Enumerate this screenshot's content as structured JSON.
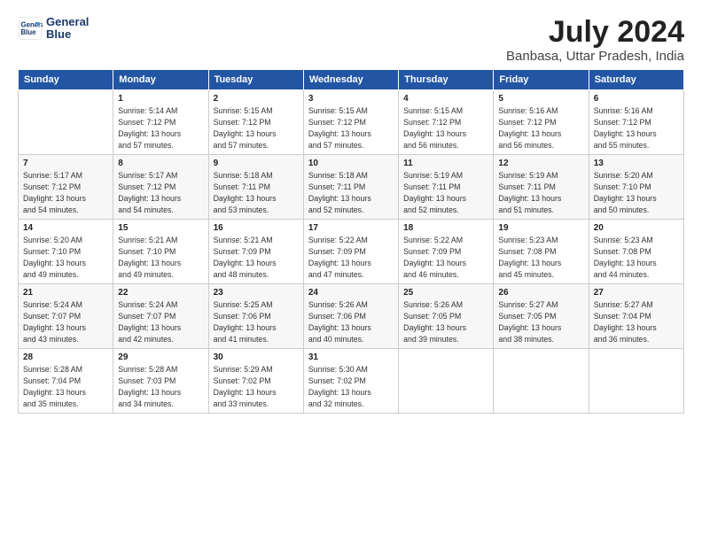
{
  "logo": {
    "line1": "General",
    "line2": "Blue"
  },
  "title": "July 2024",
  "subtitle": "Banbasa, Uttar Pradesh, India",
  "days_header": [
    "Sunday",
    "Monday",
    "Tuesday",
    "Wednesday",
    "Thursday",
    "Friday",
    "Saturday"
  ],
  "weeks": [
    [
      {
        "num": "",
        "info": ""
      },
      {
        "num": "1",
        "info": "Sunrise: 5:14 AM\nSunset: 7:12 PM\nDaylight: 13 hours\nand 57 minutes."
      },
      {
        "num": "2",
        "info": "Sunrise: 5:15 AM\nSunset: 7:12 PM\nDaylight: 13 hours\nand 57 minutes."
      },
      {
        "num": "3",
        "info": "Sunrise: 5:15 AM\nSunset: 7:12 PM\nDaylight: 13 hours\nand 57 minutes."
      },
      {
        "num": "4",
        "info": "Sunrise: 5:15 AM\nSunset: 7:12 PM\nDaylight: 13 hours\nand 56 minutes."
      },
      {
        "num": "5",
        "info": "Sunrise: 5:16 AM\nSunset: 7:12 PM\nDaylight: 13 hours\nand 56 minutes."
      },
      {
        "num": "6",
        "info": "Sunrise: 5:16 AM\nSunset: 7:12 PM\nDaylight: 13 hours\nand 55 minutes."
      }
    ],
    [
      {
        "num": "7",
        "info": "Sunrise: 5:17 AM\nSunset: 7:12 PM\nDaylight: 13 hours\nand 54 minutes."
      },
      {
        "num": "8",
        "info": "Sunrise: 5:17 AM\nSunset: 7:12 PM\nDaylight: 13 hours\nand 54 minutes."
      },
      {
        "num": "9",
        "info": "Sunrise: 5:18 AM\nSunset: 7:11 PM\nDaylight: 13 hours\nand 53 minutes."
      },
      {
        "num": "10",
        "info": "Sunrise: 5:18 AM\nSunset: 7:11 PM\nDaylight: 13 hours\nand 52 minutes."
      },
      {
        "num": "11",
        "info": "Sunrise: 5:19 AM\nSunset: 7:11 PM\nDaylight: 13 hours\nand 52 minutes."
      },
      {
        "num": "12",
        "info": "Sunrise: 5:19 AM\nSunset: 7:11 PM\nDaylight: 13 hours\nand 51 minutes."
      },
      {
        "num": "13",
        "info": "Sunrise: 5:20 AM\nSunset: 7:10 PM\nDaylight: 13 hours\nand 50 minutes."
      }
    ],
    [
      {
        "num": "14",
        "info": "Sunrise: 5:20 AM\nSunset: 7:10 PM\nDaylight: 13 hours\nand 49 minutes."
      },
      {
        "num": "15",
        "info": "Sunrise: 5:21 AM\nSunset: 7:10 PM\nDaylight: 13 hours\nand 49 minutes."
      },
      {
        "num": "16",
        "info": "Sunrise: 5:21 AM\nSunset: 7:09 PM\nDaylight: 13 hours\nand 48 minutes."
      },
      {
        "num": "17",
        "info": "Sunrise: 5:22 AM\nSunset: 7:09 PM\nDaylight: 13 hours\nand 47 minutes."
      },
      {
        "num": "18",
        "info": "Sunrise: 5:22 AM\nSunset: 7:09 PM\nDaylight: 13 hours\nand 46 minutes."
      },
      {
        "num": "19",
        "info": "Sunrise: 5:23 AM\nSunset: 7:08 PM\nDaylight: 13 hours\nand 45 minutes."
      },
      {
        "num": "20",
        "info": "Sunrise: 5:23 AM\nSunset: 7:08 PM\nDaylight: 13 hours\nand 44 minutes."
      }
    ],
    [
      {
        "num": "21",
        "info": "Sunrise: 5:24 AM\nSunset: 7:07 PM\nDaylight: 13 hours\nand 43 minutes."
      },
      {
        "num": "22",
        "info": "Sunrise: 5:24 AM\nSunset: 7:07 PM\nDaylight: 13 hours\nand 42 minutes."
      },
      {
        "num": "23",
        "info": "Sunrise: 5:25 AM\nSunset: 7:06 PM\nDaylight: 13 hours\nand 41 minutes."
      },
      {
        "num": "24",
        "info": "Sunrise: 5:26 AM\nSunset: 7:06 PM\nDaylight: 13 hours\nand 40 minutes."
      },
      {
        "num": "25",
        "info": "Sunrise: 5:26 AM\nSunset: 7:05 PM\nDaylight: 13 hours\nand 39 minutes."
      },
      {
        "num": "26",
        "info": "Sunrise: 5:27 AM\nSunset: 7:05 PM\nDaylight: 13 hours\nand 38 minutes."
      },
      {
        "num": "27",
        "info": "Sunrise: 5:27 AM\nSunset: 7:04 PM\nDaylight: 13 hours\nand 36 minutes."
      }
    ],
    [
      {
        "num": "28",
        "info": "Sunrise: 5:28 AM\nSunset: 7:04 PM\nDaylight: 13 hours\nand 35 minutes."
      },
      {
        "num": "29",
        "info": "Sunrise: 5:28 AM\nSunset: 7:03 PM\nDaylight: 13 hours\nand 34 minutes."
      },
      {
        "num": "30",
        "info": "Sunrise: 5:29 AM\nSunset: 7:02 PM\nDaylight: 13 hours\nand 33 minutes."
      },
      {
        "num": "31",
        "info": "Sunrise: 5:30 AM\nSunset: 7:02 PM\nDaylight: 13 hours\nand 32 minutes."
      },
      {
        "num": "",
        "info": ""
      },
      {
        "num": "",
        "info": ""
      },
      {
        "num": "",
        "info": ""
      }
    ]
  ]
}
